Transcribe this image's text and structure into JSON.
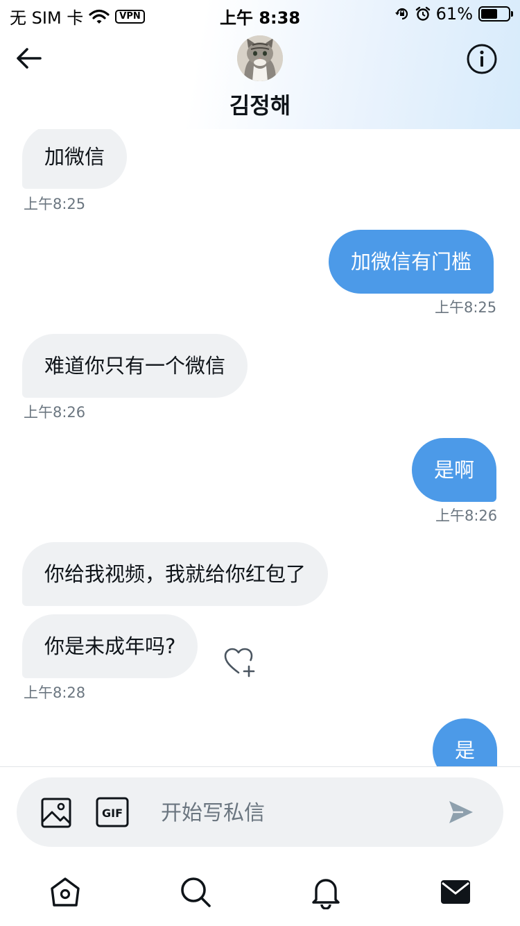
{
  "status_bar": {
    "carrier": "无 SIM 卡",
    "vpn": "VPN",
    "time": "上午 8:38",
    "battery": "61%",
    "battery_level": 0.61
  },
  "header": {
    "contact_name": "김정해"
  },
  "messages": [
    {
      "text": "加微信",
      "dir": "in"
    },
    {
      "time": "上午8:25"
    },
    {
      "text": "加微信有门槛",
      "dir": "out"
    },
    {
      "time": "上午8:25"
    },
    {
      "text": "难道你只有一个微信",
      "dir": "in"
    },
    {
      "time": "上午8:26"
    },
    {
      "text": "是啊",
      "dir": "out"
    },
    {
      "time": "上午8:26"
    },
    {
      "text": "你给我视频，我就给你红包了",
      "dir": "in"
    },
    {
      "text": "你是未成年吗?",
      "dir": "in"
    },
    {
      "time": "上午8:28"
    },
    {
      "text": "是",
      "dir": "out"
    }
  ],
  "composer": {
    "placeholder": "开始写私信",
    "gif_label": "GIF"
  },
  "icons": {
    "accent": "#4c9ae8",
    "outgoing_bubble": "#4c9ae8",
    "incoming_bubble": "#eff1f3"
  }
}
